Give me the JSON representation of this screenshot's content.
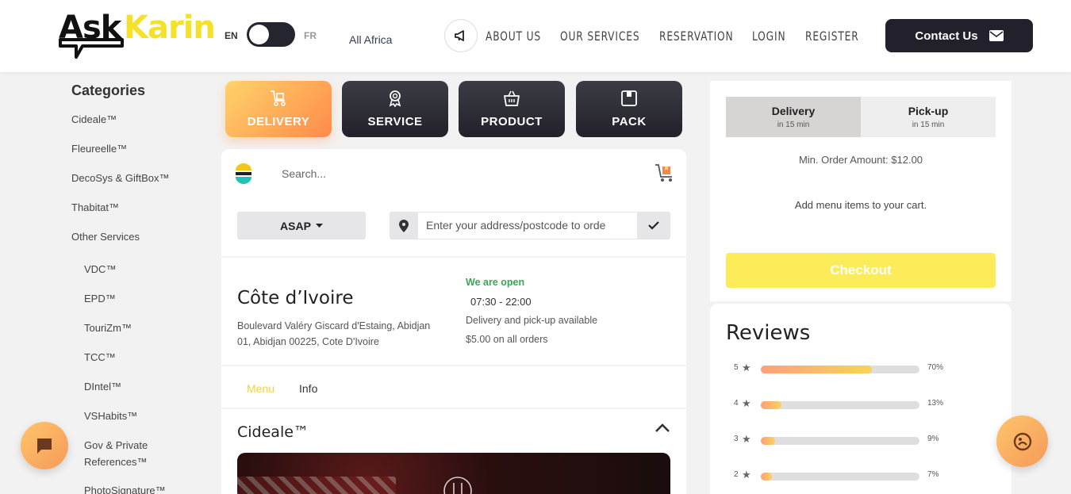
{
  "header": {
    "logo_ask": "Ask",
    "logo_karin": "Karin",
    "lang_en": "EN",
    "lang_fr": "FR",
    "region": "All Africa",
    "nav": [
      "ABOUT US",
      "OUR SERVICES",
      "RESERVATION",
      "LOGIN",
      "REGISTER"
    ],
    "contact_label": "Contact Us"
  },
  "sidebar": {
    "title": "Categories",
    "items": [
      "Cideale™",
      "Fleureelle™",
      "DecoSys & GiftBox™",
      "Thabitat™",
      "Other Services"
    ],
    "sub_items": [
      "VDC™",
      "EPD™",
      "TouriZm™",
      "TCC™",
      "DIntel™",
      "VSHabits™",
      "Gov & Private",
      "References™",
      "PhotoSignature™"
    ]
  },
  "type_tabs": [
    {
      "label": "DELIVERY",
      "icon": "cart-icon",
      "active": true
    },
    {
      "label": "SERVICE",
      "icon": "ribbon-icon",
      "active": false
    },
    {
      "label": "PRODUCT",
      "icon": "basket-icon",
      "active": false
    },
    {
      "label": "PACK",
      "icon": "box-icon",
      "active": false
    }
  ],
  "search": {
    "placeholder": "Search...",
    "asap_label": "ASAP",
    "address_placeholder": "Enter your address/postcode to orde"
  },
  "store": {
    "country": "Côte d’Ivoire",
    "address_line1": "Boulevard Valéry Giscard d'Estaing, Abidjan",
    "address_line2": "01, Abidjan 00225, Cote D'Ivoire",
    "open_status": "We are open",
    "hours": "07:30 - 22:00",
    "availability": "Delivery and pick-up available",
    "fee": "$5.00 on all orders"
  },
  "menu_tabs": {
    "menu": "Menu",
    "info": "Info"
  },
  "section": {
    "title": "Cideale™"
  },
  "cart": {
    "delivery_label": "Delivery",
    "delivery_time": "in 15 min",
    "pickup_label": "Pick-up",
    "pickup_time": "in 15 min",
    "min_order": "Min. Order Amount: $12.00",
    "empty_text": "Add menu items to your cart.",
    "checkout_label": "Checkout"
  },
  "reviews": {
    "title": "Reviews",
    "rows": [
      {
        "stars": "5",
        "percent_label": "70%",
        "percent": 70
      },
      {
        "stars": "4",
        "percent_label": "13%",
        "percent": 13
      },
      {
        "stars": "3",
        "percent_label": "9%",
        "percent": 9
      },
      {
        "stars": "2",
        "percent_label": "7%",
        "percent": 7
      }
    ]
  },
  "colors": {
    "accent_yellow": "#f5e12a",
    "dark": "#22212b",
    "orange_gradient_start": "#ffd36a",
    "orange_gradient_end": "#ff8a4a",
    "open_green": "#3aa655"
  }
}
